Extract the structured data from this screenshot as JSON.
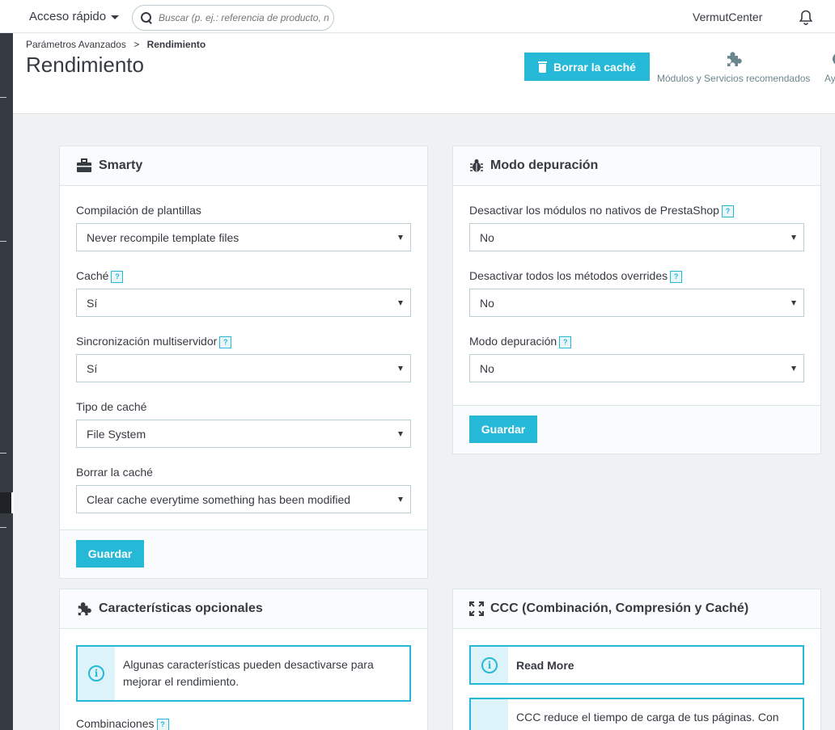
{
  "header": {
    "quick_access_label": "Acceso rápido",
    "search_placeholder": "Buscar (p. ej.: referencia de producto, nombre de cliente…)",
    "shop_name": "VermutCenter"
  },
  "page": {
    "breadcrumb_parent": "Parámetros Avanzados",
    "breadcrumb_sep": ">",
    "breadcrumb_current": "Rendimiento",
    "title": "Rendimiento",
    "clear_cache_button": "Borrar la caché",
    "toolbar_modules_label": "Módulos y Servicios recomendados",
    "toolbar_help_label": "Ay"
  },
  "smarty": {
    "title": "Smarty",
    "fields": [
      {
        "label": "Compilación de plantillas",
        "value": "Never recompile template files"
      },
      {
        "label": "Caché",
        "value": "Sí"
      },
      {
        "label": "Sincronización multiservidor",
        "value": "Sí"
      },
      {
        "label": "Tipo de caché",
        "value": "File System"
      },
      {
        "label": "Borrar la caché",
        "value": "Clear cache everytime something has been modified"
      }
    ],
    "save_label": "Guardar"
  },
  "debug": {
    "title": "Modo depuración",
    "fields": [
      {
        "label": "Desactivar los módulos no nativos de PrestaShop",
        "value": "No"
      },
      {
        "label": "Desactivar todos los métodos overrides",
        "value": "No"
      },
      {
        "label": "Modo depuración",
        "value": "No"
      }
    ],
    "save_label": "Guardar"
  },
  "optional": {
    "title": "Características opcionales",
    "alert_text": "Algunas características pueden desactivarse para mejorar el rendimiento.",
    "combinations_label": "Combinaciones"
  },
  "ccc": {
    "title": "CCC (Combinación, Compresión y Caché)",
    "read_more": "Read More",
    "description": "CCC reduce el tiempo de carga de tus páginas. Con"
  },
  "help_glyph": "?",
  "info_glyph": "i",
  "colors": {
    "accent": "#25b9d7",
    "sidebar": "#363a41",
    "background": "#eff1f2"
  }
}
